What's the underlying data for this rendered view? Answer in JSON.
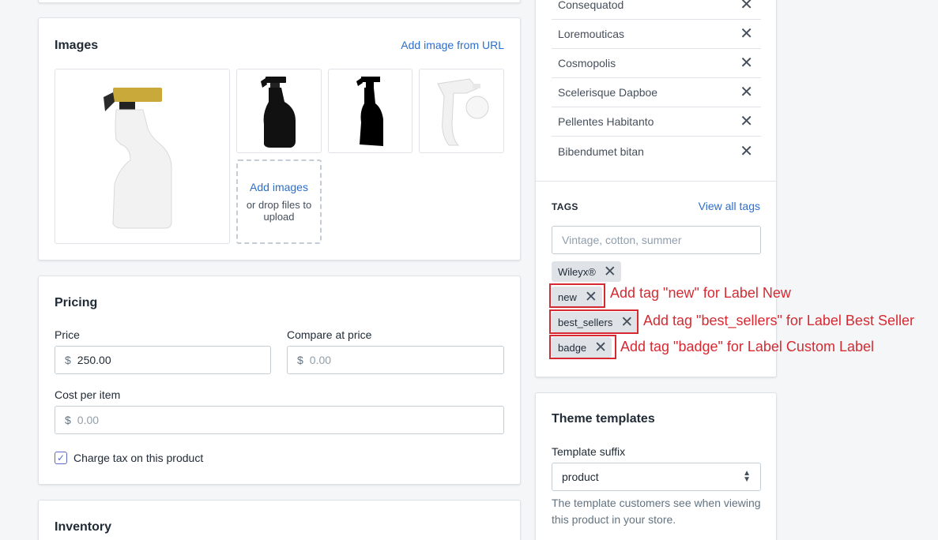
{
  "images": {
    "title": "Images",
    "add_from_url": "Add image from URL",
    "dropzone": {
      "add_label": "Add images",
      "hint": "or drop files to upload"
    },
    "thumbnails": [
      "spray-bottle-white-gold-trigger",
      "spray-bottle-black",
      "spray-bottle-black-silhouette",
      "spray-trigger-white"
    ]
  },
  "pricing": {
    "title": "Pricing",
    "price_label": "Price",
    "price_currency": "$",
    "price_value": "250.00",
    "compare_label": "Compare at price",
    "compare_currency": "$",
    "compare_placeholder": "0.00",
    "cost_label": "Cost per item",
    "cost_currency": "$",
    "cost_placeholder": "0.00",
    "charge_tax_label": "Charge tax on this product",
    "charge_tax_checked": true
  },
  "inventory": {
    "title": "Inventory"
  },
  "collections": {
    "items": [
      "Consequatod",
      "Loremouticas",
      "Cosmopolis",
      "Scelerisque Dapboe",
      "Pellentes Habitanto",
      "Bibendumet bitan"
    ]
  },
  "tags": {
    "heading": "TAGS",
    "view_all": "View all tags",
    "placeholder": "Vintage, cotton, summer",
    "items": [
      "Wileyx®",
      "new",
      "best_sellers",
      "badge"
    ]
  },
  "annotations": {
    "new": "Add tag \"new\" for Label New",
    "best_sellers": "Add tag \"best_sellers\" for Label Best Seller",
    "badge": "Add tag \"badge\" for Label Custom Label",
    "color": "#d62a32"
  },
  "theme": {
    "title": "Theme templates",
    "suffix_label": "Template suffix",
    "suffix_value": "product",
    "help": "The template customers see when viewing this product in your store."
  },
  "colors": {
    "background": "#f4f6f8",
    "link": "#2c6ecb",
    "checkbox": "#5c6ac4"
  }
}
